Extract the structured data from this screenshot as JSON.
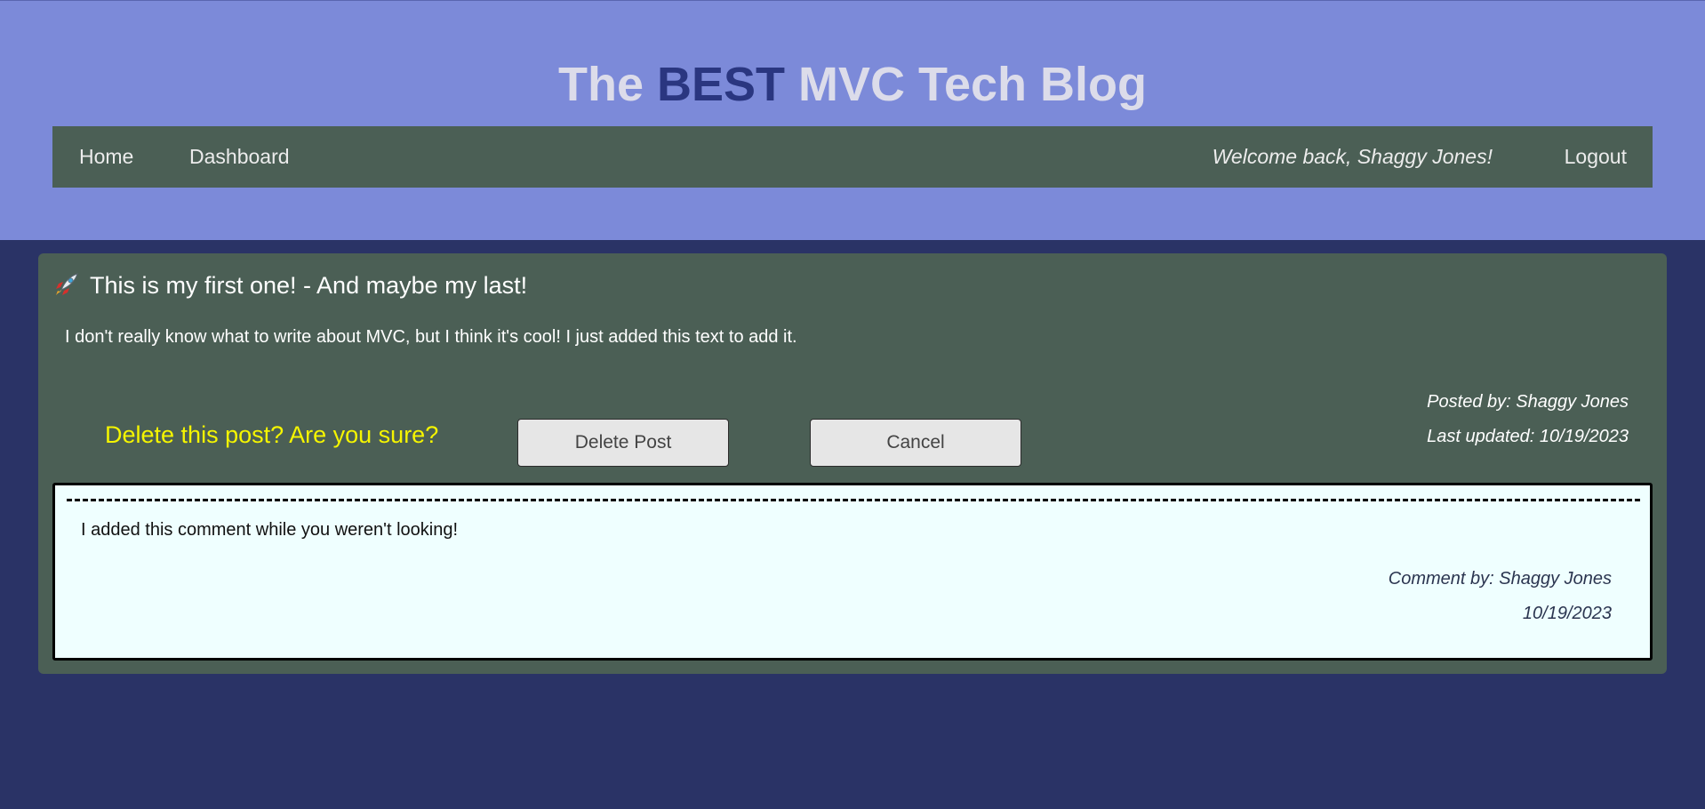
{
  "header": {
    "title_prefix": "The ",
    "title_accent": "BEST",
    "title_suffix": " MVC Tech Blog"
  },
  "nav": {
    "home": "Home",
    "dashboard": "Dashboard",
    "welcome": "Welcome back, Shaggy Jones!",
    "logout": "Logout"
  },
  "post": {
    "icon": "rocket-icon",
    "title": "This is my first one! - And maybe my last!",
    "body": "I don't really know what to write about MVC, but I think it's cool! I just added this text to add it.",
    "posted_by": "Posted by: Shaggy Jones",
    "last_updated": "Last updated: 10/19/2023"
  },
  "confirm": {
    "prompt": "Delete this post? Are you sure?",
    "delete_label": "Delete Post",
    "cancel_label": "Cancel"
  },
  "comments": [
    {
      "text": "I added this comment while you weren't looking!",
      "author": "Comment by: Shaggy Jones",
      "date": "10/19/2023"
    }
  ],
  "colors": {
    "header_bg": "#7c8ad9",
    "page_bg": "#2a3366",
    "card_bg": "#4b5f55",
    "title_accent": "#2a3680",
    "confirm_text": "#f5f500",
    "comment_bg": "#efffff"
  }
}
